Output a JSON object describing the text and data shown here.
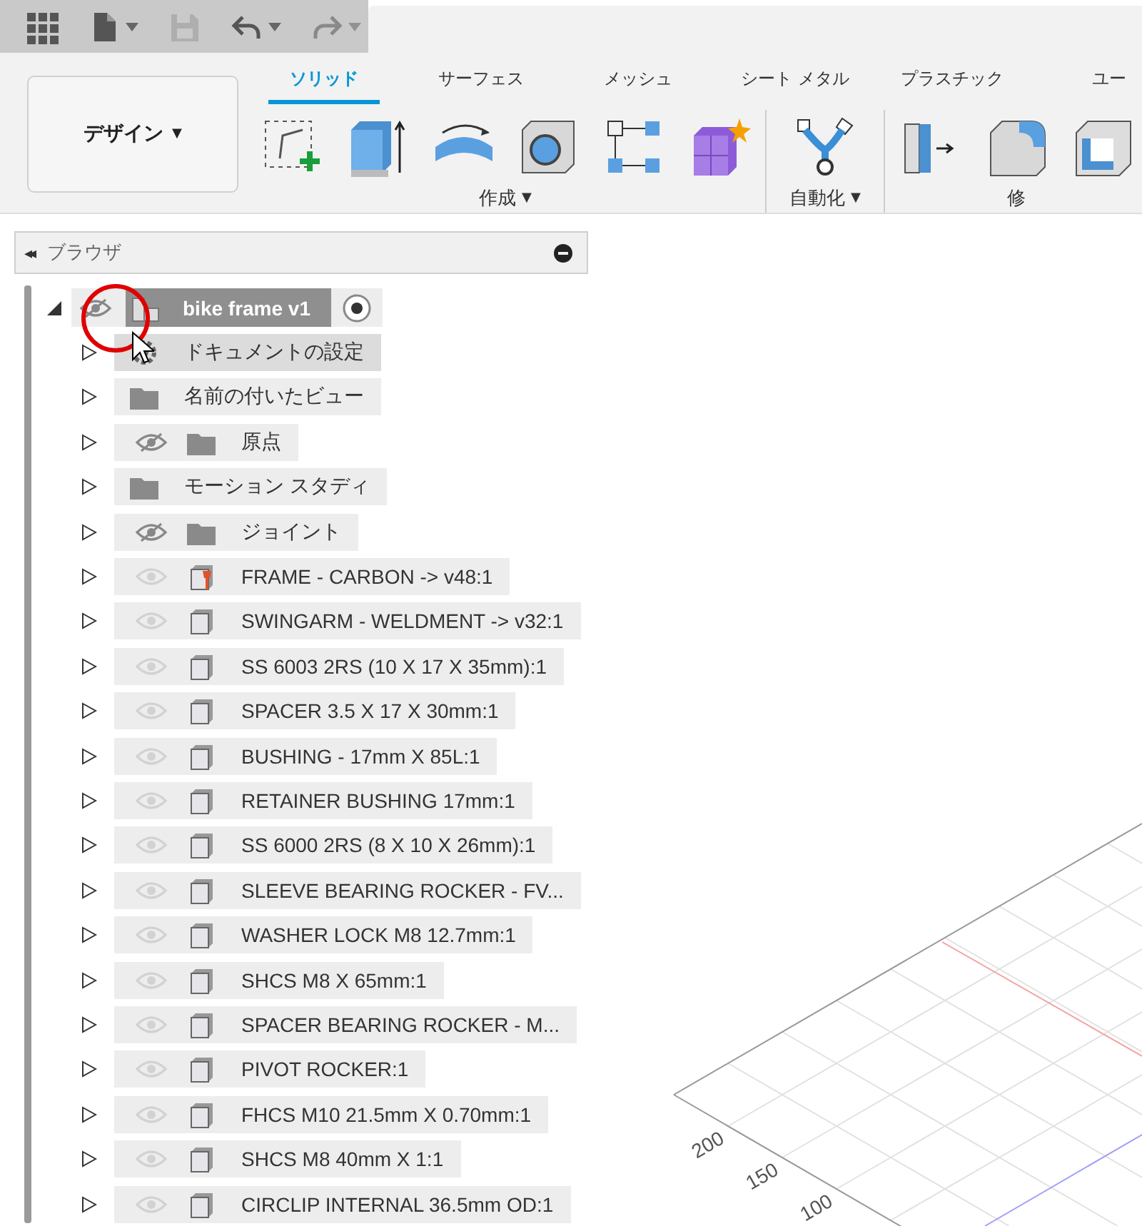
{
  "quick_access": [
    {
      "kind": "grid",
      "disabled": false,
      "menu": false
    },
    {
      "kind": "file",
      "disabled": false,
      "menu": true
    },
    {
      "kind": "save",
      "disabled": true,
      "menu": false
    },
    {
      "kind": "undo",
      "disabled": false,
      "menu": true
    },
    {
      "kind": "redo",
      "disabled": true,
      "menu": true
    }
  ],
  "workspace": {
    "label": "デザイン",
    "caret": "▼"
  },
  "tabs": [
    {
      "label": "ソリッド",
      "selected": true
    },
    {
      "label": "サーフェス",
      "selected": false
    },
    {
      "label": "メッシュ",
      "selected": false
    },
    {
      "label": "シート メタル",
      "selected": false
    },
    {
      "label": "プラスチック",
      "selected": false
    },
    {
      "label": "ユー",
      "selected": false
    }
  ],
  "groups": [
    {
      "label": "作成",
      "caret": "▼",
      "tools": [
        {
          "kind": "sketch"
        },
        {
          "kind": "extrude"
        },
        {
          "kind": "revolve"
        },
        {
          "kind": "hole"
        },
        {
          "kind": "pattern"
        },
        {
          "kind": "generate"
        }
      ]
    },
    {
      "label": "自動化",
      "caret": "▼",
      "tools": [
        {
          "kind": "automate"
        }
      ]
    },
    {
      "label": "修",
      "tools": [
        {
          "kind": "pressPull"
        },
        {
          "kind": "fillet"
        },
        {
          "kind": "shell"
        }
      ]
    }
  ],
  "browser": {
    "title": "ブラウザ",
    "collapse": "◂◂",
    "root": {
      "name": "bike frame v1",
      "expanded": true,
      "visible": false,
      "active": true,
      "annotated": true,
      "children": [
        {
          "name": "ドキュメントの設定",
          "kind": "settings",
          "expanded": false,
          "hover": true
        },
        {
          "name": "名前の付いたビュー",
          "kind": "folder",
          "expanded": false,
          "hover": false
        },
        {
          "name": "原点",
          "kind": "folder",
          "expanded": false,
          "hover": false,
          "visible": false
        },
        {
          "name": "モーション スタディ",
          "kind": "folder",
          "expanded": false,
          "hover": false
        },
        {
          "name": "ジョイント",
          "kind": "folder",
          "expanded": false,
          "hover": false,
          "visible": false
        },
        {
          "name": "FRAME - CARBON -> v48:1",
          "kind": "linked",
          "expanded": false,
          "hover": false,
          "visible": true
        },
        {
          "name": "SWINGARM - WELDMENT -> v32:1",
          "kind": "component",
          "expanded": false,
          "hover": false,
          "visible": true
        },
        {
          "name": "SS 6003 2RS (10 X 17 X 35mm):1",
          "kind": "component",
          "expanded": false,
          "hover": false,
          "visible": true
        },
        {
          "name": "SPACER 3.5 X 17 X 30mm:1",
          "kind": "component",
          "expanded": false,
          "hover": false,
          "visible": true
        },
        {
          "name": "BUSHING - 17mm X 85L:1",
          "kind": "component",
          "expanded": false,
          "hover": false,
          "visible": true
        },
        {
          "name": "RETAINER BUSHING 17mm:1",
          "kind": "component",
          "expanded": false,
          "hover": false,
          "visible": true
        },
        {
          "name": "SS 6000 2RS (8 X 10 X 26mm):1",
          "kind": "component",
          "expanded": false,
          "hover": false,
          "visible": true
        },
        {
          "name": "SLEEVE BEARING ROCKER - FV...",
          "kind": "component",
          "expanded": false,
          "hover": false,
          "visible": true
        },
        {
          "name": "WASHER LOCK M8 12.7mm:1",
          "kind": "component",
          "expanded": false,
          "hover": false,
          "visible": true
        },
        {
          "name": "SHCS M8 X 65mm:1",
          "kind": "component",
          "expanded": false,
          "hover": false,
          "visible": true
        },
        {
          "name": "SPACER BEARING ROCKER - M...",
          "kind": "component",
          "expanded": false,
          "hover": false,
          "visible": true
        },
        {
          "name": "PIVOT ROCKER:1",
          "kind": "component",
          "expanded": false,
          "hover": false,
          "visible": true
        },
        {
          "name": "FHCS M10 21.5mm X 0.70mm:1",
          "kind": "component",
          "expanded": false,
          "hover": false,
          "visible": true
        },
        {
          "name": "SHCS M8 40mm X 1:1",
          "kind": "component",
          "expanded": false,
          "hover": false,
          "visible": true
        },
        {
          "name": "CIRCLIP INTERNAL 36.5mm OD:1",
          "kind": "component",
          "expanded": false,
          "hover": false,
          "visible": true
        }
      ]
    }
  },
  "viewport": {
    "axis_labels": [
      "200",
      "150",
      "100"
    ]
  }
}
